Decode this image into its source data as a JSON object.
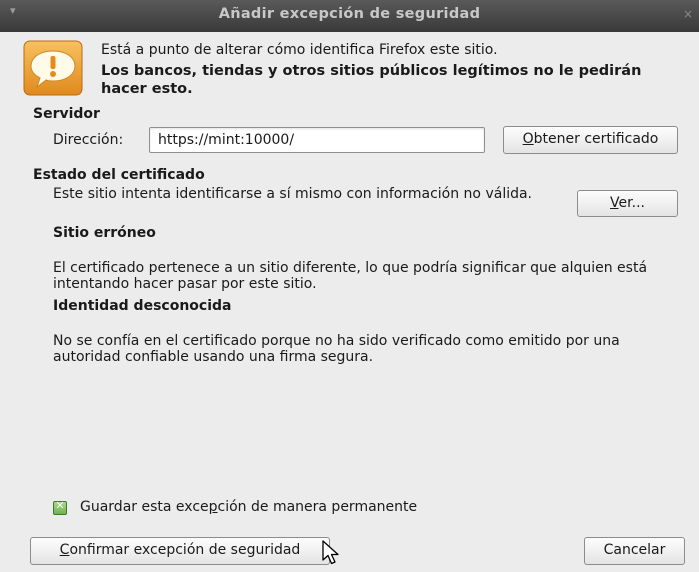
{
  "window": {
    "title": "Añadir excepción de seguridad",
    "menu_glyph": "▾",
    "close_glyph": "×"
  },
  "intro": {
    "line1": "Está a punto de alterar cómo identifica Firefox este sitio.",
    "line2": "Los bancos, tiendas y otros sitios públicos legítimos no le pedirán hacer esto.",
    "icon": "warning-speech-bubble-icon"
  },
  "server": {
    "heading": "Servidor",
    "address_label": "Dirección:",
    "address_value": "https://mint:10000/",
    "get_cert_button": {
      "mnemonic": "O",
      "rest": "btener certificado"
    }
  },
  "cert_status": {
    "heading": "Estado del certificado",
    "invalid_info": "Este sitio intenta identificarse a sí mismo con información no válida.",
    "view_button": {
      "mnemonic": "V",
      "rest": "er..."
    },
    "wrong_site_title": "Sitio erróneo",
    "wrong_site_text": "El certificado pertenece a un sitio diferente, lo que podría significar que alquien está intentando hacer pasar por este sitio.",
    "unknown_identity_title": "Identidad desconocida",
    "unknown_identity_text": "No se confía en el certificado porque no ha sido verificado como emitido por una autoridad confiable usando una firma segura."
  },
  "permanent": {
    "checked": true,
    "check_glyph": "✕",
    "label_before": "Guardar esta exce",
    "label_mnemonic": "p",
    "label_after": "ción de manera permanente"
  },
  "footer": {
    "confirm_button": {
      "mnemonic": "C",
      "rest": "onfirmar excepción de seguridad"
    },
    "cancel_button": "Cancelar"
  },
  "colors": {
    "titlebar": "#3a3a3a",
    "dialog_bg": "#ececec",
    "warning_orange": "#f2a134",
    "checkbox_green": "#6fb34e"
  }
}
